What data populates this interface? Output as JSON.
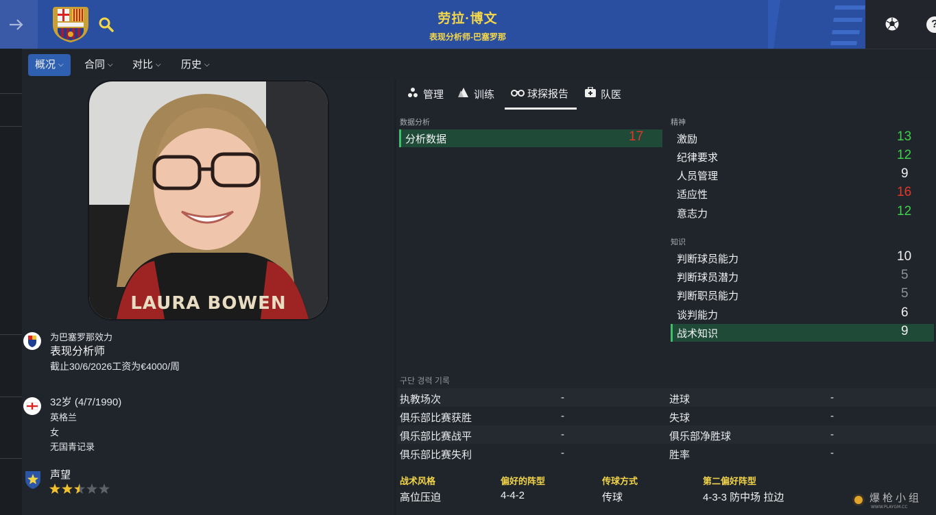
{
  "header": {
    "name": "劳拉·博文",
    "subtitle": "表现分析师-巴塞罗那",
    "colors": {
      "bar": "#2a4ea0",
      "title": "#f5d84a"
    }
  },
  "tabs": [
    {
      "label": "概况",
      "active": true
    },
    {
      "label": "合同",
      "active": false
    },
    {
      "label": "对比",
      "active": false
    },
    {
      "label": "历史",
      "active": false
    }
  ],
  "photo": {
    "caption": "LAURA BOWEN"
  },
  "club_info": {
    "plays_for": "为巴塞罗那效力",
    "role": "表现分析师",
    "contract": "截止30/6/2026工资为€4000/周"
  },
  "personal": {
    "age": "32岁 (4/7/1990)",
    "nationality": "英格兰",
    "gender": "女",
    "youth": "无国青记录"
  },
  "reputation": {
    "label": "声望",
    "stars": 2.5,
    "max_stars": 5
  },
  "subtabs": [
    {
      "label": "管理",
      "icon": "manage-icon"
    },
    {
      "label": "训练",
      "icon": "training-icon"
    },
    {
      "label": "球探报告",
      "icon": "binoculars-icon",
      "active": true
    },
    {
      "label": "队医",
      "icon": "medical-icon"
    }
  ],
  "analysis": {
    "section": "数据分析",
    "items": [
      {
        "label": "分析数据",
        "value": "17",
        "color": "red"
      }
    ]
  },
  "mental": {
    "section": "精神",
    "items": [
      {
        "label": "激励",
        "value": "13",
        "color": "green"
      },
      {
        "label": "纪律要求",
        "value": "12",
        "color": "green"
      },
      {
        "label": "人员管理",
        "value": "9",
        "color": "white"
      },
      {
        "label": "适应性",
        "value": "16",
        "color": "red"
      },
      {
        "label": "意志力",
        "value": "12",
        "color": "green"
      }
    ]
  },
  "knowledge": {
    "section": "知识",
    "items": [
      {
        "label": "判断球员能力",
        "value": "10",
        "color": "white"
      },
      {
        "label": "判断球员潜力",
        "value": "5",
        "color": "grey"
      },
      {
        "label": "判断职员能力",
        "value": "5",
        "color": "grey"
      },
      {
        "label": "谈判能力",
        "value": "6",
        "color": "white"
      },
      {
        "label": "战术知识",
        "value": "9",
        "color": "white"
      }
    ]
  },
  "career": {
    "label": "구단 경력 기록",
    "rows": [
      {
        "l1": "执教场次",
        "v1": "-",
        "l2": "进球",
        "v2": "-"
      },
      {
        "l1": "俱乐部比赛获胜",
        "v1": "-",
        "l2": "失球",
        "v2": "-"
      },
      {
        "l1": "俱乐部比赛战平",
        "v1": "-",
        "l2": "俱乐部净胜球",
        "v2": "-"
      },
      {
        "l1": "俱乐部比赛失利",
        "v1": "-",
        "l2": "胜率",
        "v2": "-"
      }
    ]
  },
  "style": [
    {
      "head": "战术风格",
      "value": "高位压迫"
    },
    {
      "head": "偏好的阵型",
      "value": "4-4-2"
    },
    {
      "head": "传球方式",
      "value": "传球"
    },
    {
      "head": "第二偏好阵型",
      "value": "4-3-3 防中场 拉边"
    }
  ],
  "watermark": {
    "text": "爆枪小组",
    "sub": "WWW.PLAYGM.CC"
  }
}
